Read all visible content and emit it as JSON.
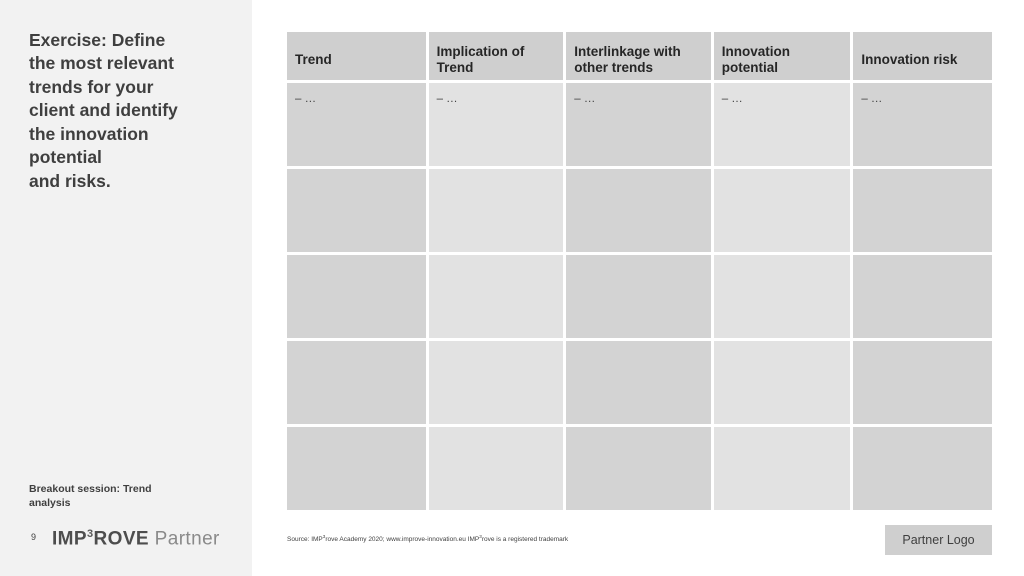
{
  "slide": {
    "title": "Exercise: Define\nthe most relevant\ntrends for your\nclient and identify\nthe innovation\npotential\nand risks.",
    "footer_session": "Breakout session: Trend\nanalysis",
    "page_number": "9",
    "logo": {
      "bold": "IMP",
      "sup": "3",
      "bold2": "ROVE",
      "light": "Partner"
    },
    "source": {
      "prefix": "Source: IMP",
      "sup1": "3",
      "mid": "rove Academy 2020; www.improve-innovation.eu IMP",
      "sup2": "3",
      "suffix": "rove is a registered trademark"
    },
    "partner_logo_label": "Partner Logo"
  },
  "table": {
    "headers": [
      "Trend",
      "Implication of\nTrend",
      "Interlinkage with\nother trends",
      "Innovation\npotential",
      "Innovation risk"
    ],
    "first_row": [
      "–  …",
      "–  …",
      "–  …",
      "–  …",
      "–  …"
    ],
    "empty_rows": 4
  },
  "colors": {
    "panel_background": "#f2f2f2",
    "header_cell": "#cfcfcf",
    "cell_dark": "#d3d3d3",
    "cell_light": "#e2e2e2",
    "text": "#3f3f3f"
  }
}
